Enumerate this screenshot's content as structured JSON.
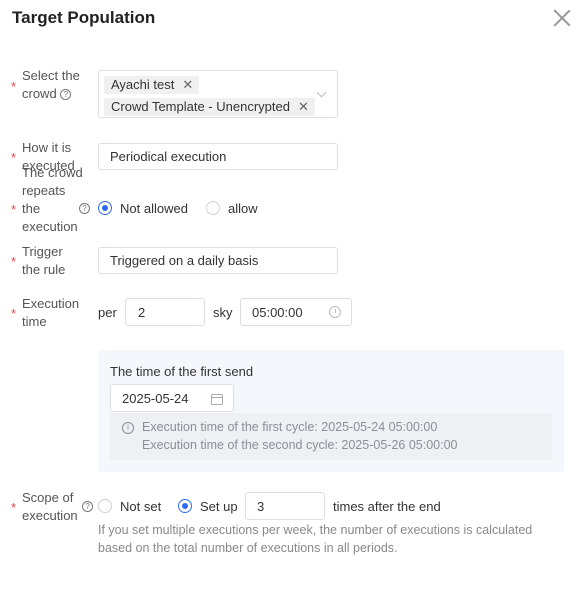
{
  "dialog": {
    "title": "Target Population"
  },
  "crowd": {
    "label": "Select the crowd",
    "tags": [
      "Ayachi test",
      "Crowd Template - Unencrypted"
    ],
    "tag_remove": "✕"
  },
  "execution_mode": {
    "label": "How it is executed",
    "value": "Periodical execution"
  },
  "repeat": {
    "label": "The crowd repeats the execution",
    "options": [
      "Not allowed",
      "allow"
    ],
    "selected": "Not allowed"
  },
  "trigger": {
    "label": "Trigger the rule",
    "value": "Triggered on a daily basis"
  },
  "exec_time": {
    "label": "Execution time",
    "per": "per",
    "interval": "2",
    "unit": "sky",
    "time": "05:00:00"
  },
  "first_send": {
    "title": "The time of the first send",
    "date": "2025-05-24",
    "info_lines": [
      "Execution time of the first cycle: 2025-05-24 05:00:00",
      "Execution time of the second cycle: 2025-05-26 05:00:00"
    ]
  },
  "scope": {
    "label": "Scope of execution",
    "options": [
      "Not set",
      "Set up"
    ],
    "selected": "Set up",
    "count": "3",
    "suffix": "times after the end",
    "hint": "If you set multiple executions per week, the number of executions is calculated based on the total number of executions in all periods."
  },
  "colors": {
    "accent": "#2f6bf2",
    "required": "#e5484d"
  },
  "icons": [
    "close-icon",
    "help-icon",
    "chevron-down-icon",
    "clock-icon",
    "calendar-icon",
    "info-icon"
  ]
}
